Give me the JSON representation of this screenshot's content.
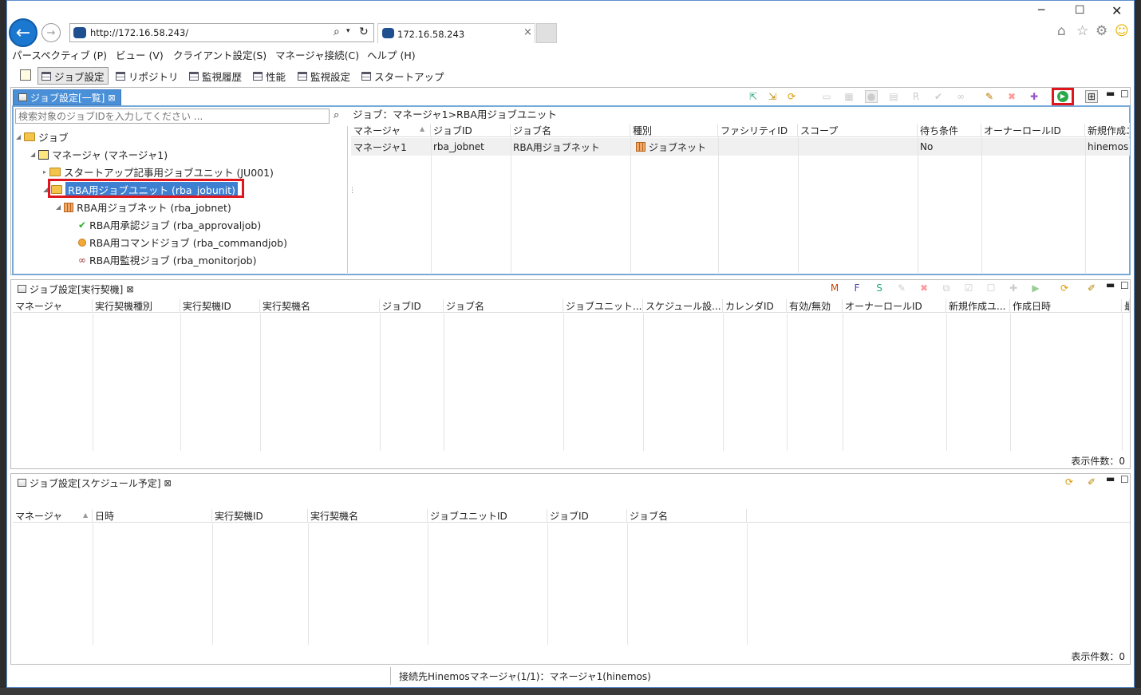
{
  "browser": {
    "url": "http://172.16.58.243/",
    "tab_title": "172.16.58.243",
    "window_controls": [
      "minimize-icon",
      "maximize-icon",
      "close-icon"
    ]
  },
  "menu": [
    "パースペクティブ (P)",
    "ビュー (V)",
    "クライアント設定(S)",
    "マネージャ接続(C)",
    "ヘルプ (H)"
  ],
  "perspectives": [
    "ジョブ設定",
    "リポジトリ",
    "監視履歴",
    "性能",
    "監視設定",
    "スタートアップ"
  ],
  "job_list_view": {
    "tab_label": "ジョブ設定[一覧]",
    "search_placeholder": "検索対象のジョブIDを入力してください ...",
    "breadcrumb": "ジョブ：マネージャ1>RBA用ジョブユニット",
    "tree": [
      {
        "label": "ジョブ",
        "level": 0
      },
      {
        "label": "マネージャ (マネージャ1)",
        "level": 1
      },
      {
        "label": "スタートアップ記事用ジョブユニット (JU001)",
        "level": 2
      },
      {
        "label": "RBA用ジョブユニット (rba_jobunit)",
        "level": 2,
        "selected": true
      },
      {
        "label": "RBA用ジョブネット (rba_jobnet)",
        "level": 3
      },
      {
        "label": "RBA用承認ジョブ (rba_approvaljob)",
        "level": 4
      },
      {
        "label": "RBA用コマンドジョブ (rba_commandjob)",
        "level": 4
      },
      {
        "label": "RBA用監視ジョブ (rba_monitorjob)",
        "level": 4
      }
    ],
    "columns": [
      "マネージャ",
      "ジョブID",
      "ジョブ名",
      "種別",
      "ファシリティID",
      "スコープ",
      "待ち条件",
      "オーナーロールID",
      "新規作成ユ"
    ],
    "rows": [
      [
        "マネージャ1",
        "rba_jobnet",
        "RBA用ジョブネット",
        "ジョブネット",
        "",
        "",
        "No",
        "",
        "hinemos"
      ]
    ]
  },
  "trigger_view": {
    "tab_label": "ジョブ設定[実行契機]",
    "columns": [
      "マネージャ",
      "実行契機種別",
      "実行契機ID",
      "実行契機名",
      "ジョブID",
      "ジョブ名",
      "ジョブユニット...",
      "スケジュール設...",
      "カレンダID",
      "有効/無効",
      "オーナーロールID",
      "新規作成ユ...",
      "作成日時",
      "最"
    ],
    "count_label": "表示件数：0"
  },
  "schedule_view": {
    "tab_label": "ジョブ設定[スケジュール予定]",
    "columns": [
      "マネージャ",
      "日時",
      "実行契機ID",
      "実行契機名",
      "ジョブユニットID",
      "ジョブID",
      "ジョブ名"
    ],
    "count_label": "表示件数：0"
  },
  "status_bar": "接続先Hinemosマネージャ(1/1)：マネージャ1(hinemos)",
  "colors": {
    "accent": "#4a90d9",
    "highlight": "#e0161e",
    "run_green": "#2ba84a"
  }
}
